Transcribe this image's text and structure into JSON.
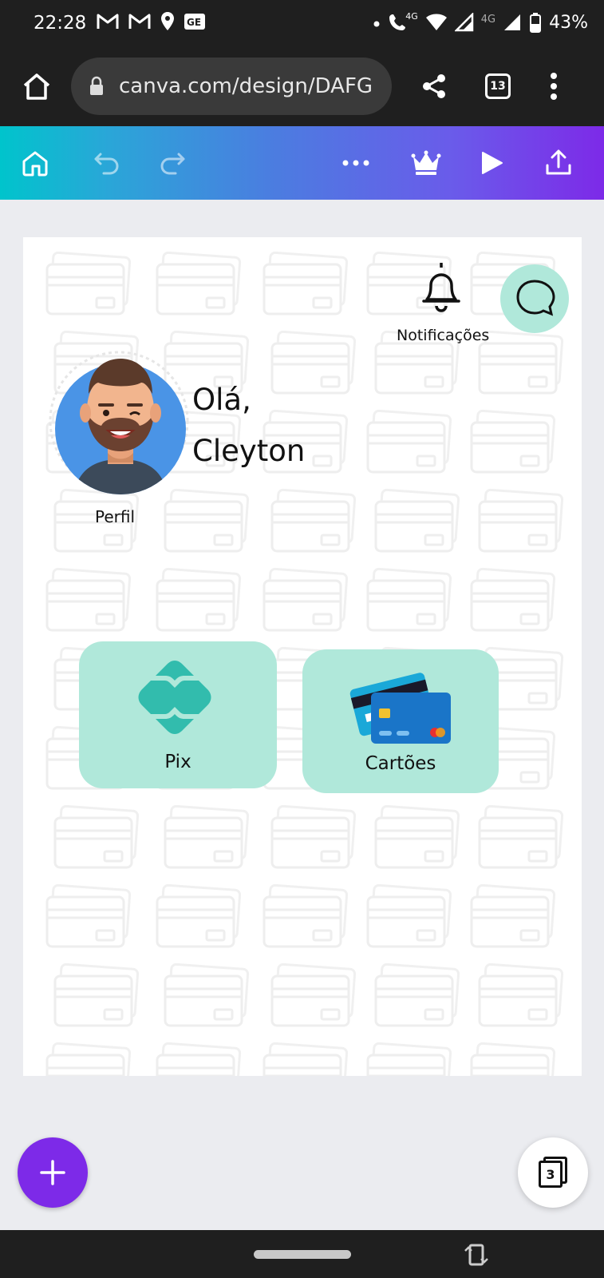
{
  "status_bar": {
    "time": "22:28",
    "battery_percent": "43%",
    "network_labels": [
      "4G",
      "4G"
    ]
  },
  "browser": {
    "url": "canva.com/design/DAFG",
    "tab_count": "13"
  },
  "canva_toolbar": {
    "gradient_colors": [
      "#00c4cc",
      "#7d2ae8"
    ]
  },
  "design": {
    "notifications_label": "Notificações",
    "greeting_line1": "Olá,",
    "greeting_line2": "Cleyton",
    "profile_label": "Perfil",
    "tiles": [
      {
        "label": "Pix",
        "icon": "pix-icon"
      },
      {
        "label": "Cartões",
        "icon": "credit-cards-icon"
      }
    ],
    "tile_color": "#b0e8da",
    "accent_color": "#32bcad"
  },
  "fab": {
    "page_count": "3",
    "add_color": "#7d2ae8"
  }
}
